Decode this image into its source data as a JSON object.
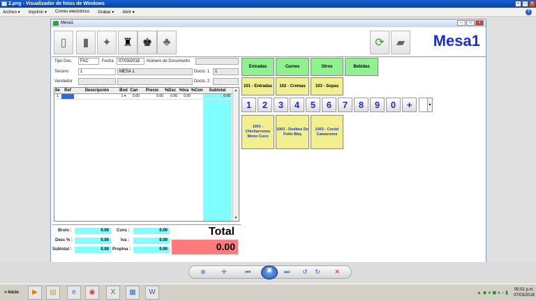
{
  "window": {
    "title": "2.png - Visualizador de fotos de Windows",
    "min": "–",
    "max": "□",
    "close": "×"
  },
  "menu": {
    "items": [
      {
        "label": "Archivo ▾"
      },
      {
        "label": "Imprimir ▾"
      },
      {
        "label": "Correo electrónico"
      },
      {
        "label": "Grabar ▾"
      },
      {
        "label": "Abrir ▾"
      }
    ],
    "help": "?"
  },
  "app": {
    "title": "Mesa1",
    "heading": "Mesa1",
    "form": {
      "tipo_doc_label": "Tipo Doc.",
      "tipo_doc": "FAC",
      "fecha_label": "Fecha",
      "fecha": "07/03/2018",
      "numero_label": "Número de Documento",
      "numero": "",
      "tercero_label": "Tercero",
      "tercero_code": "1",
      "tercero_name": "MESA 1",
      "docto1_label": "Docto. 1",
      "docto1": "1",
      "vendedor_label": "Vendedor",
      "vendedor": "",
      "docto2_label": "Docto. 2",
      "docto2": ""
    },
    "grid": {
      "headers": [
        "Ite",
        "Ref",
        "Descripción",
        "Bod",
        "Can",
        "Precio",
        "%Dsc",
        "%Iva",
        "%Con",
        "Subtotal"
      ],
      "row": {
        "ite": "1",
        "bod": "1 ▾",
        "can": "0.00",
        "precio": "0.00",
        "dsc": "0.00",
        "iva": "0.00",
        "con": "",
        "subtotal": "0.00"
      }
    },
    "totals": {
      "bruto_label": "Bruto :",
      "bruto": "0.00",
      "desc_label": "Desc % :",
      "desc": "0.00",
      "subtotal_label": "Subtotal :",
      "subtotal": "0.00",
      "cons_label": "Cons :",
      "cons": "0.00",
      "iva_label": "Iva :",
      "iva": "0.00",
      "propina_label": "Propina :",
      "propina": "0.00",
      "total_label": "Total",
      "total": "0.00"
    },
    "categories": [
      "Entradas",
      "Carnes",
      "Otros",
      "Bebidas"
    ],
    "subcategories": [
      "101 - Entradas",
      "102 - Cremas",
      "103 - Sopas"
    ],
    "numpad": [
      "1",
      "2",
      "3",
      "4",
      "5",
      "6",
      "7",
      "8",
      "9",
      "0",
      "+"
    ],
    "products": [
      "1001 - Chicharrones Mono Cuco",
      "1002 - Deditos De Pollo Bbq",
      "1003 - Coctel Camarones"
    ]
  },
  "taskbar": {
    "start": "Inicio",
    "time": "05:02 p.m.",
    "date": "07/03/2018"
  },
  "colors": {
    "accent_blue": "#1a2cde",
    "cyan": "#7fffff",
    "total_red": "#ff7b7b",
    "green_btn": "#8ff28f",
    "yellow_btn": "#f2f08e"
  }
}
